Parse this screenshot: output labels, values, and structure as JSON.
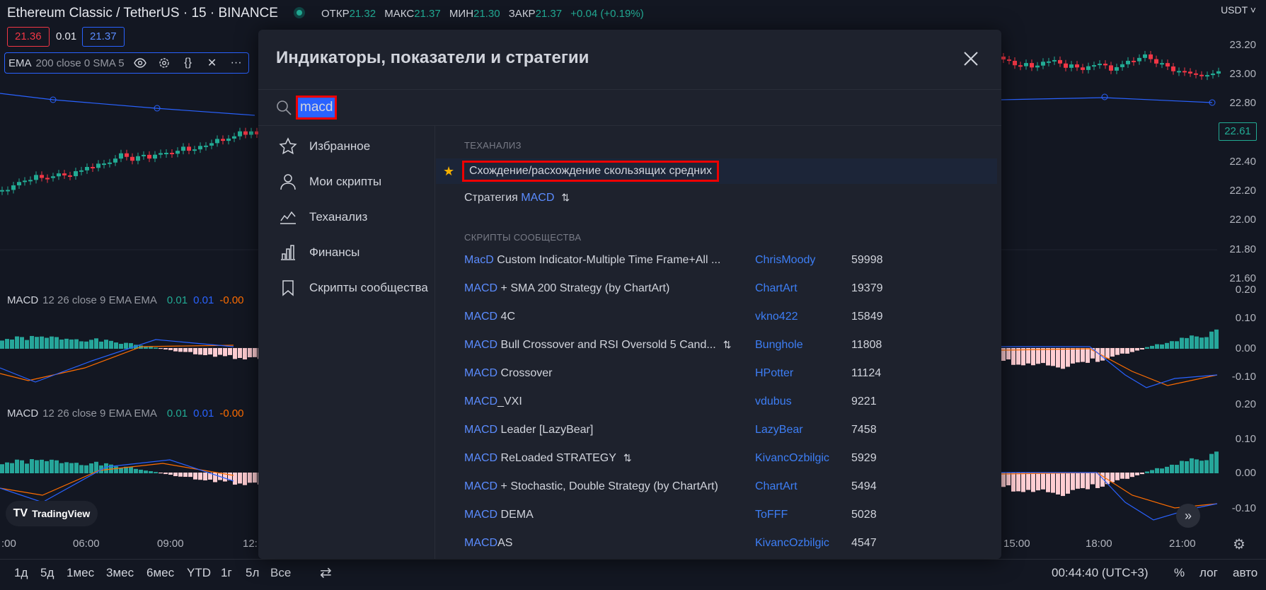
{
  "header": {
    "symbol": "Ethereum Classic / TetherUS · 15 · BINANCE",
    "ohlc": [
      {
        "label": "ОТКР",
        "value": "21.32"
      },
      {
        "label": "МАКС",
        "value": "21.37"
      },
      {
        "label": "МИН",
        "value": "21.30"
      },
      {
        "label": "ЗАКР",
        "value": "21.37"
      }
    ],
    "change": "+0.04 (+0.19%)",
    "sell_price": "21.36",
    "spread": "0.01",
    "buy_price": "21.37"
  },
  "ema_legend": {
    "name": "EMA",
    "params": "200 close 0 SMA 5"
  },
  "macd_legends": [
    {
      "name": "MACD",
      "params": "12 26 close 9 EMA EMA",
      "v1": "0.01",
      "v2": "0.01",
      "v3": "-0.00"
    },
    {
      "name": "MACD",
      "params": "12 26 close 9 EMA EMA",
      "v1": "0.01",
      "v2": "0.01",
      "v3": "-0.00"
    }
  ],
  "currency": "USDT",
  "price_axis": [
    "23.20",
    "23.00",
    "22.80",
    "22.40",
    "22.20",
    "22.00",
    "21.80",
    "21.60"
  ],
  "current_price": "22.61",
  "macd_axis_1": [
    "0.20",
    "0.10",
    "0.00",
    "-0.10"
  ],
  "macd_axis_2": [
    "0.20",
    "0.10",
    "0.00",
    "-0.10"
  ],
  "time_axis": [
    ":00",
    "06:00",
    "09:00",
    "12:",
    "15:00",
    "18:00",
    "21:00"
  ],
  "ranges": [
    "1д",
    "5д",
    "1мес",
    "3мес",
    "6мес",
    "YTD",
    "1г",
    "5л",
    "Все"
  ],
  "clock": "00:44:40 (UTC+3)",
  "scale_buttons": [
    "%",
    "лог",
    "авто"
  ],
  "logo": "TradingView",
  "modal": {
    "title": "Индикаторы, показатели и стратегии",
    "search_value": "macd",
    "nav": [
      {
        "label": "Избранное",
        "icon": "star-icon"
      },
      {
        "label": "Мои скрипты",
        "icon": "user-icon"
      },
      {
        "label": "Теханализ",
        "icon": "chart-icon"
      },
      {
        "label": "Финансы",
        "icon": "bars-icon"
      },
      {
        "label": "Скрипты сообщества",
        "icon": "bookmark-icon"
      }
    ],
    "section_tech": "ТЕХАНАЛИЗ",
    "tech_items": [
      {
        "title": "Схождение/расхождение скользящих средних"
      },
      {
        "prefix": "Стратегия ",
        "hl": "MACD"
      }
    ],
    "section_community": "СКРИПТЫ СООБЩЕСТВА",
    "community": [
      {
        "hl": "MacD",
        "rest": " Custom Indicator-Multiple Time Frame+All ...",
        "author": "ChrisMoody",
        "count": "59998"
      },
      {
        "hl": "MACD",
        "rest": " + SMA 200 Strategy (by ChartArt)",
        "author": "ChartArt",
        "count": "19379"
      },
      {
        "hl": "MACD",
        "rest": " 4C",
        "author": "vkno422",
        "count": "15849"
      },
      {
        "hl": "MACD",
        "rest": " Bull Crossover and RSI Oversold 5 Cand...",
        "author": "Bunghole",
        "count": "11808",
        "strategy": true
      },
      {
        "hl": "MACD",
        "rest": " Crossover",
        "author": "HPotter",
        "count": "11124"
      },
      {
        "hl": "MACD",
        "rest": "_VXI",
        "author": "vdubus",
        "count": "9221"
      },
      {
        "hl": "MACD",
        "rest": " Leader [LazyBear]",
        "author": "LazyBear",
        "count": "7458"
      },
      {
        "hl": "MACD",
        "rest": " ReLoaded STRATEGY",
        "author": "KivancOzbilgic",
        "count": "5929",
        "strategy": true
      },
      {
        "hl": "MACD",
        "rest": " + Stochastic, Double Strategy (by ChartArt)",
        "author": "ChartArt",
        "count": "5494"
      },
      {
        "hl": "MACD",
        "rest": " DEMA",
        "author": "ToFFF",
        "count": "5028"
      },
      {
        "hl": "MACD",
        "rest": "AS",
        "author": "KivancOzbilgic",
        "count": "4547"
      }
    ]
  },
  "colors": {
    "up": "#22ab94",
    "down": "#f23645",
    "accent": "#2962ff",
    "macd_signal": "#ff6d00"
  }
}
